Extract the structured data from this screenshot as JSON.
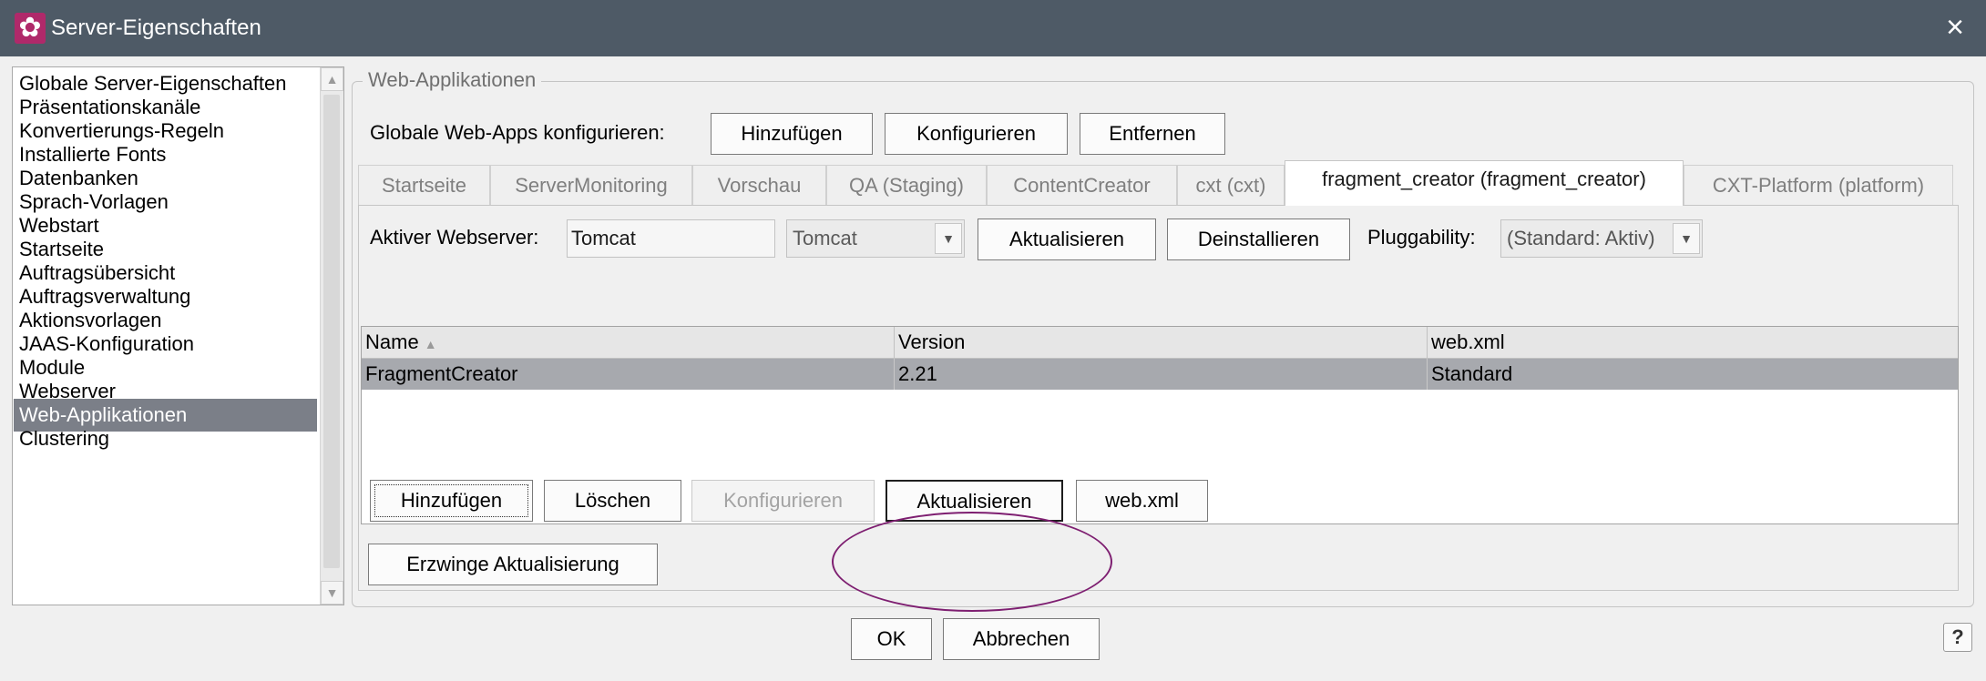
{
  "window": {
    "title": "Server-Eigenschaften",
    "close_icon": "×",
    "app_icon": "✿"
  },
  "nav": {
    "items": [
      "Globale Server-Eigenschaften",
      "Präsentationskanäle",
      "Konvertierungs-Regeln",
      "Installierte Fonts",
      "Datenbanken",
      "Sprach-Vorlagen",
      "Webstart",
      "Startseite",
      "Auftragsübersicht",
      "Auftragsverwaltung",
      "Aktionsvorlagen",
      "JAAS-Konfiguration",
      "Module",
      "Webserver",
      "Web-Applikationen",
      "Clustering"
    ],
    "selected": "Web-Applikationen",
    "scroll_up_icon": "▲",
    "scroll_down_icon": "▼"
  },
  "group": {
    "title": "Web-Applikationen",
    "global_label": "Globale Web-Apps konfigurieren:",
    "global_buttons": {
      "add": "Hinzufügen",
      "configure": "Konfigurieren",
      "remove": "Entfernen"
    }
  },
  "tabs": [
    "Startseite",
    "ServerMonitoring",
    "Vorschau",
    "QA (Staging)",
    "ContentCreator",
    "cxt (cxt)",
    "fragment_creator (fragment_creator)",
    "CXT-Platform (platform)"
  ],
  "active_tab": "fragment_creator (fragment_creator)",
  "panel": {
    "webserver_label": "Aktiver Webserver:",
    "webserver_value": "Tomcat",
    "webserver_combo": "Tomcat",
    "update_button": "Aktualisieren",
    "uninstall_button": "Deinstallieren",
    "pluggability_label": "Pluggability:",
    "pluggability_value": "(Standard: Aktiv)",
    "dropdown_icon": "▼"
  },
  "table": {
    "columns": [
      "Name",
      "Version",
      "web.xml"
    ],
    "sort_icon": "▲",
    "rows": [
      {
        "name": "FragmentCreator",
        "version": "2.21",
        "webxml": "Standard"
      }
    ]
  },
  "actions": {
    "add": "Hinzufügen",
    "delete": "Löschen",
    "configure": "Konfigurieren",
    "update": "Aktualisieren",
    "webxml": "web.xml",
    "force_update": "Erzwinge Aktualisierung"
  },
  "footer": {
    "ok": "OK",
    "cancel": "Abbrechen",
    "help_icon": "?"
  },
  "colors": {
    "titlebar": "#4e5a66",
    "selection": "#7b7f88",
    "table_selection": "#a7a9ae",
    "annotation": "#7e1f71"
  }
}
